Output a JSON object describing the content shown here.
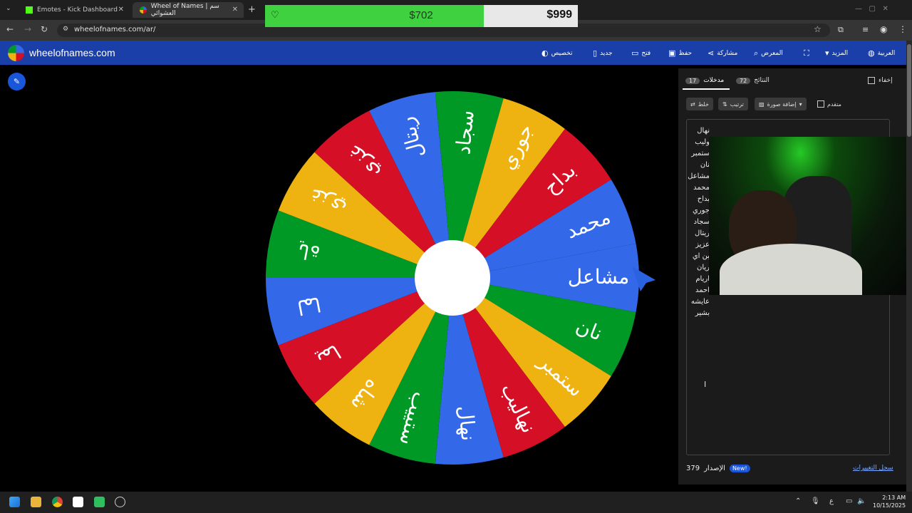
{
  "browser": {
    "tabs": [
      {
        "label": "Emotes - Kick Dashboard"
      },
      {
        "label": "Wheel of Names | سم العشوائي"
      }
    ],
    "new_tab": "+",
    "url": "wheelofnames.com/ar/"
  },
  "donation": {
    "raised": "$702",
    "goal": "$999",
    "progress": 0.7
  },
  "app": {
    "title": "wheelofnames.com",
    "menu": [
      {
        "label": "العربية",
        "icon": "globe-icon"
      },
      {
        "label": "المزيد",
        "icon": "caret-icon"
      },
      {
        "label": "",
        "icon": "fullscreen-icon"
      },
      {
        "label": "المعرض",
        "icon": "search-icon"
      },
      {
        "label": "مشاركة",
        "icon": "share-icon"
      },
      {
        "label": "حفظ",
        "icon": "save-icon"
      },
      {
        "label": "فتح",
        "icon": "folder-icon"
      },
      {
        "label": "جديد",
        "icon": "file-icon"
      },
      {
        "label": "تخصيص",
        "icon": "palette-icon"
      }
    ]
  },
  "wheel": {
    "colors": [
      "#3369e8",
      "#009925",
      "#eeb211",
      "#d50f25"
    ],
    "slice_labels": [
      "مشاعل",
      "نان",
      "ستمبر",
      "نهاليب",
      "نهال",
      "ستييب",
      "شاه",
      "يما",
      "لما",
      "ياة",
      "غزي",
      "غزي",
      "ريتال",
      "سجاد",
      "جوري",
      "بداح",
      "محمد"
    ]
  },
  "panel": {
    "hide_label": "إخفاء",
    "results_label": "النتائج",
    "results_count": "72",
    "entries_label": "مدخلات",
    "entries_count": "17",
    "tools": {
      "shuffle": "خلط",
      "sort": "ترتيب",
      "add_image": "إضافة صورة",
      "advanced": "متقدم"
    },
    "entries": [
      "نهال",
      "وليب",
      "ستمبر",
      "نان",
      "مشاعل",
      "محمد",
      "بداح",
      "جوري",
      "سجاد",
      "ريتال",
      "عزيز",
      "بن اي",
      "ريان",
      "اريام",
      "احمد",
      "عايشه",
      "بشير"
    ],
    "version_label": "الإصدار",
    "version_number": "379",
    "new_badge": "New!",
    "changelog_link": "سجل التغييرات"
  },
  "taskbar": {
    "time": "2:13 AM",
    "date": "10/15/2025",
    "lang": "ع"
  }
}
